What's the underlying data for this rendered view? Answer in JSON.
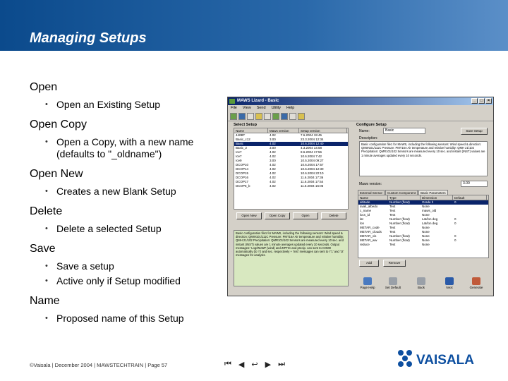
{
  "header": {
    "title": "Managing Setups"
  },
  "outline": [
    {
      "title": "Open",
      "bullets": [
        "Open an Existing Setup"
      ]
    },
    {
      "title": "Open Copy",
      "bullets": [
        "Open a Copy, with a new name (defaults to \"_oldname\")"
      ]
    },
    {
      "title": "Open New",
      "bullets": [
        "Creates a new Blank Setup"
      ]
    },
    {
      "title": "Delete",
      "bullets": [
        "Delete a selected Setup"
      ]
    },
    {
      "title": "Save",
      "bullets": [
        "Save a setup",
        "Active only if Setup modified"
      ]
    },
    {
      "title": "Name",
      "bullets": [
        "Proposed name of this Setup"
      ]
    }
  ],
  "window": {
    "title": "MAWS Lizard - Basic",
    "menu": [
      "File",
      "View",
      "Send",
      "Utility",
      "Help"
    ],
    "select_setup": {
      "label": "Select Setup",
      "columns": [
        "Name",
        "Maws version",
        "Setup version"
      ],
      "rows": [
        [
          "440BT",
          "4.02",
          "7.6.2004 19:45"
        ],
        [
          "Basic_c12",
          "3.00",
          "23.3.2004 12:34"
        ],
        [
          "Basic",
          "4.02",
          "10.6.2004 12:40"
        ],
        [
          "Basic_2",
          "3.00",
          "4.3.2004 14:58"
        ],
        [
          "Ice7",
          "4.02",
          "8.6.2004 17:56"
        ],
        [
          "Ice7",
          "4.02",
          "10.6.2004 7:42"
        ],
        [
          "Ice9",
          "3.00",
          "10.5.2004 09:27"
        ],
        [
          "DCOP10",
          "4.02",
          "10.6.2004 17:57"
        ],
        [
          "DCOP14",
          "4.02",
          "10.6.2004 12:30"
        ],
        [
          "DCOP15",
          "4.02",
          "10.6.2004 22:10"
        ],
        [
          "DCOP16",
          "4.02",
          "11.6.2004 17:36"
        ],
        [
          "DCOP17",
          "4.02",
          "11.6.2004 17:54"
        ],
        [
          "DCOP5_b",
          "4.02",
          "11.6.2004 16:05"
        ]
      ],
      "selected_index": 2
    },
    "bottom_text": "Basic configuration file1 for MAWS, including the following sensors: Wind speed & direction: QMW101/111C Pressure: PMT16A Air temperature and relative humidity: QMH 21/102 Precipitation: QMR101/102 Sensors are measured every 10 sec. and instant (INST) values are 1 minute averages updated every 10 seconds. Output messages: 'Log/WLWP (wind) and ZIPTIC and precip. can sent to COM0 automatically (to 'r') and sec. respectively + 'Inst' messages can sent to 'r'1' and 'r2' messages for analysis.",
    "buttons": {
      "open_new": "Open New",
      "open_copy": "Open Copy",
      "open": "Open",
      "delete": "Delete",
      "save_setup": "Save Setup",
      "add": "Add",
      "remove": "Remove"
    },
    "configure": {
      "label": "Configure Setup",
      "name_label": "Name:",
      "name_value": "Basic",
      "desc_label": "Description:",
      "desc_text": "Basic configuration file1 for MAWS, including the following sensors: Wind speed & direction: QMW101/111C Pressure: PMT16A Air temperature and relative humidity: QMH 21/102 Precipitation: QMR101/102 Sensors are measured every 10 sec. and instant (INST) values are 1 minute averages updated every 10 seconds.",
      "maws_label": "Maws version:",
      "maws_value": "3.00",
      "tabs": [
        "External Sensor",
        "Custom Component",
        "Basic Parameters"
      ],
      "param_columns": [
        "Name",
        "Type",
        "Dimension",
        "Default"
      ],
      "params": [
        [
          "altitude",
          "Number (float)",
          "Grade h",
          "0"
        ],
        [
          "avail_albedo",
          "Text",
          "None",
          ""
        ],
        [
          "c_name",
          "Text",
          "maws_old",
          ""
        ],
        [
          "locs_id",
          "Text",
          "None",
          ""
        ],
        [
          "lat",
          "Number (float)",
          "Lat/lon deg",
          "0"
        ],
        [
          "lon",
          "Number (float)",
          "Lat/lon deg",
          "0"
        ],
        [
          "METAR_code",
          "Text",
          "None",
          ""
        ],
        [
          "METAR_clouds",
          "Text",
          "None",
          ""
        ],
        [
          "METAR_vis",
          "Number (float)",
          "None",
          "0"
        ],
        [
          "METAR_ww",
          "Number (float)",
          "None",
          "0"
        ],
        [
          "reduce",
          "Text",
          "None",
          ""
        ]
      ]
    },
    "nav": [
      "Page Help",
      "Set Default",
      "Back",
      "Next",
      "Generate"
    ]
  },
  "footer": {
    "text": "©Vaisala | December 2004 | MAWSTECHTRAIN | Page 57",
    "nav_glyphs": [
      "⏮",
      "◀",
      "↩",
      "▶",
      "⏭"
    ]
  },
  "logo": {
    "text": "VAISALA",
    "color": "#0d4fa0"
  },
  "colors": {
    "header_blue": "#0b4a8c",
    "selection": "#0a246a",
    "panel_green": "#d8e8c0"
  }
}
